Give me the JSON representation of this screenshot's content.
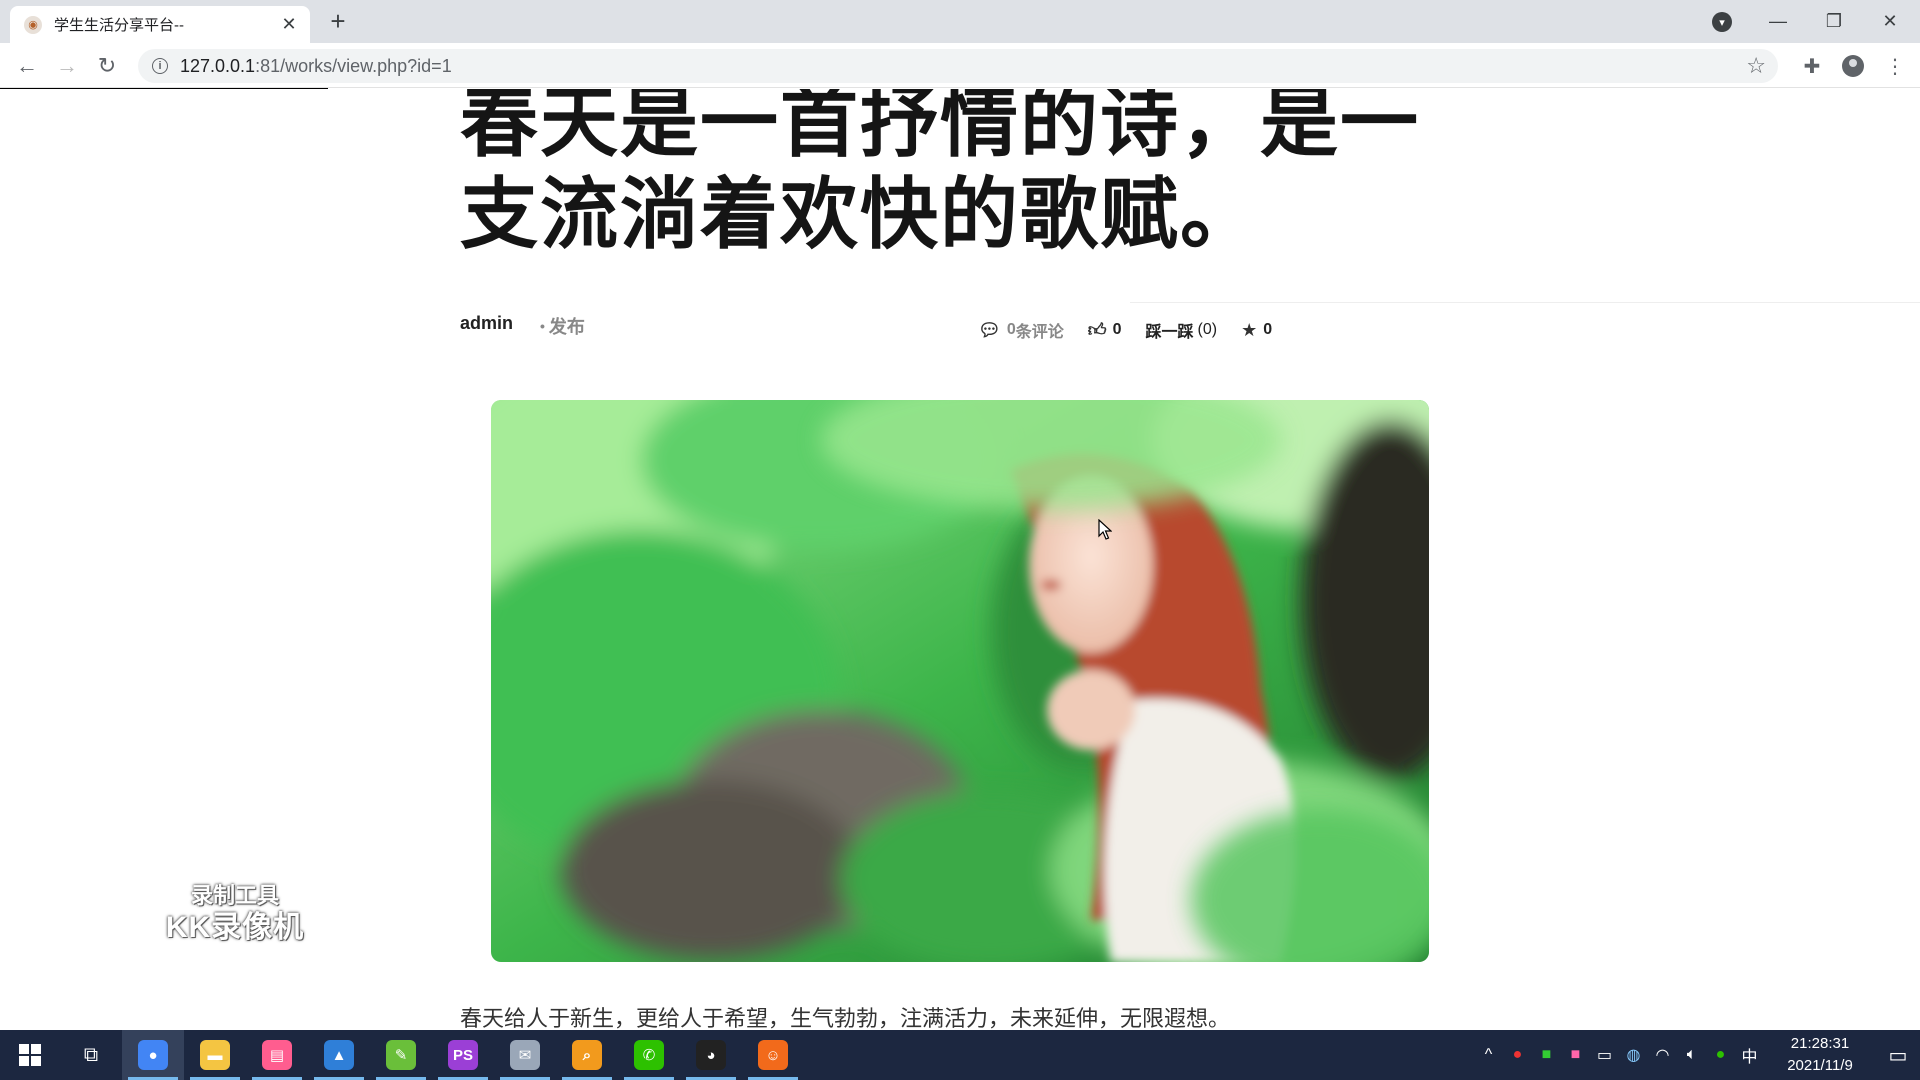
{
  "browser": {
    "tab_title": "学生生活分享平台--",
    "url_host": "127.0.0.1",
    "url_rest": ":81/works/view.php?id=1"
  },
  "article": {
    "title": "春天是一首抒情的诗，是一支流淌着欢快的歌赋。",
    "author": "admin",
    "publish_label": "发布",
    "comments_count": "0",
    "comments_label": "条评论",
    "likes_count": "0",
    "dislike_label": "踩一踩",
    "dislike_count": "(0)",
    "favorites_count": "0",
    "paragraph": "春天给人于新生，更给人于希望，生气勃勃，注满活力，未来延伸，无限遐想。"
  },
  "watermark": {
    "line1": "录制工具",
    "line2": "KK录像机"
  },
  "taskbar": {
    "apps": [
      {
        "name": "chrome",
        "color": "#4285f4",
        "glyph": "●"
      },
      {
        "name": "file-explorer",
        "color": "#f4c542",
        "glyph": "▬"
      },
      {
        "name": "app-pink",
        "color": "#ff5d8f",
        "glyph": "▤"
      },
      {
        "name": "photos",
        "color": "#2f7fd8",
        "glyph": "▲"
      },
      {
        "name": "app-green",
        "color": "#6abf3a",
        "glyph": "✎"
      },
      {
        "name": "phpstorm",
        "color": "#9b3fd6",
        "glyph": "PS"
      },
      {
        "name": "app-gray",
        "color": "#9aa7b8",
        "glyph": "✉"
      },
      {
        "name": "search-app",
        "color": "#f29a1d",
        "glyph": "⌕"
      },
      {
        "name": "wechat",
        "color": "#2dc100",
        "glyph": "✆"
      },
      {
        "name": "qq",
        "color": "#222",
        "glyph": "◕"
      },
      {
        "name": "app-orange",
        "color": "#f26a1b",
        "glyph": "☺"
      }
    ],
    "ime": "中",
    "time": "21:28:31",
    "date": "2021/11/9"
  }
}
